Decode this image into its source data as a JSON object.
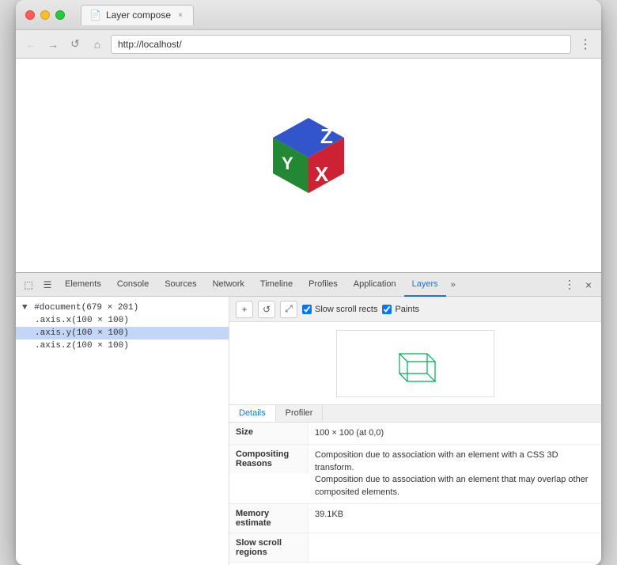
{
  "window": {
    "title": "Layer compose",
    "tab_icon": "📄",
    "close_label": "×"
  },
  "address_bar": {
    "back_icon": "←",
    "forward_icon": "→",
    "reload_icon": "↺",
    "home_icon": "⌂",
    "url": "http://localhost/",
    "menu_icon": "⋮"
  },
  "devtools": {
    "tabs": [
      {
        "id": "elements",
        "label": "Elements",
        "active": false
      },
      {
        "id": "console",
        "label": "Console",
        "active": false
      },
      {
        "id": "sources",
        "label": "Sources",
        "active": false
      },
      {
        "id": "network",
        "label": "Network",
        "active": false
      },
      {
        "id": "timeline",
        "label": "Timeline",
        "active": false
      },
      {
        "id": "profiles",
        "label": "Profiles",
        "active": false
      },
      {
        "id": "application",
        "label": "Application",
        "active": false
      },
      {
        "id": "layers",
        "label": "Layers",
        "active": true
      }
    ],
    "more_tabs_icon": "»",
    "options_icon": "⋮",
    "close_icon": "×",
    "inspect_icon": "⬚",
    "console_icon": "☰"
  },
  "tree": {
    "items": [
      {
        "id": "doc",
        "label": "#document(679 × 201)",
        "level": 0,
        "arrow": "▼",
        "selected": false
      },
      {
        "id": "axis-x",
        "label": ".axis.x(100 × 100)",
        "level": 1,
        "arrow": "",
        "selected": false
      },
      {
        "id": "axis-y",
        "label": ".axis.y(100 × 100)",
        "level": 1,
        "arrow": "",
        "selected": true
      },
      {
        "id": "axis-z",
        "label": ".axis.z(100 × 100)",
        "level": 1,
        "arrow": "",
        "selected": false
      }
    ]
  },
  "layers_toolbar": {
    "add_icon": "+",
    "rotate_icon": "↺",
    "move_icon": "⤢",
    "slow_scroll_label": "Slow scroll rects",
    "paints_label": "Paints",
    "slow_scroll_checked": true,
    "paints_checked": true
  },
  "layer_detail_tabs": [
    {
      "id": "details",
      "label": "Details",
      "active": true
    },
    {
      "id": "profiler",
      "label": "Profiler",
      "active": false
    }
  ],
  "layer_details": {
    "size_label": "Size",
    "size_value": "100 × 100 (at 0,0)",
    "compositing_label": "Compositing\nReasons",
    "compositing_value": "Composition due to association with an element with a CSS 3D transform.\nComposition due to association with an element that may overlap other composited elements.",
    "memory_label": "Memory\nestimate",
    "memory_value": "39.1KB",
    "slow_scroll_label": "Slow scroll\nregions",
    "slow_scroll_value": ""
  }
}
